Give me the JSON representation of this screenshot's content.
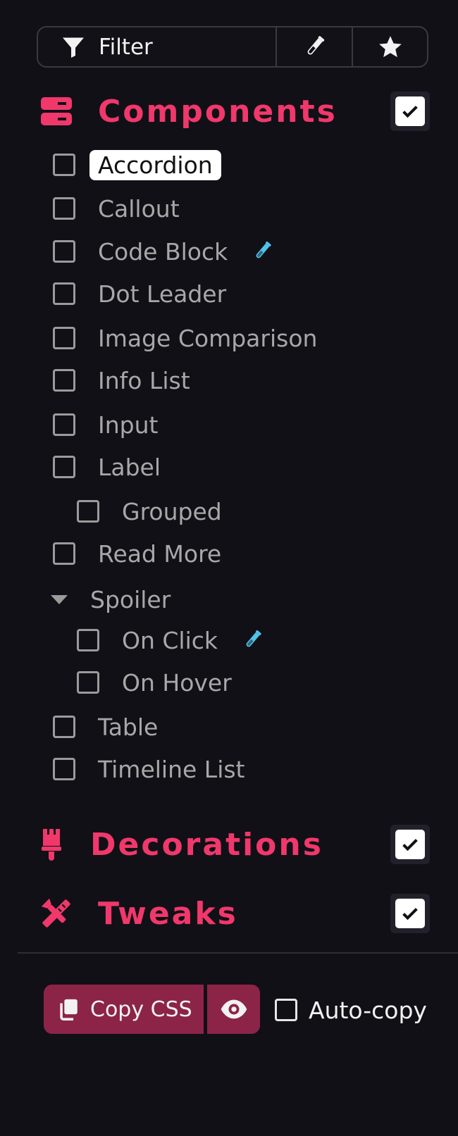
{
  "toolbar": {
    "filter_label": "Filter",
    "filter_icon": "funnel-icon",
    "beaker_icon": "beaker-icon",
    "star_icon": "star-icon"
  },
  "sections": {
    "components": {
      "title": "Components",
      "icon": "server-icon",
      "checked": true
    },
    "decorations": {
      "title": "Decorations",
      "icon": "paintbrush-icon",
      "checked": true
    },
    "tweaks": {
      "title": "Tweaks",
      "icon": "tools-icon",
      "checked": true
    }
  },
  "components": {
    "accordion": "Accordion",
    "callout": "Callout",
    "code_block": "Code Block",
    "dot_leader": "Dot Leader",
    "image_comparison": "Image Comparison",
    "info_list": "Info List",
    "input": "Input",
    "label": "Label",
    "grouped": "Grouped",
    "read_more": "Read More",
    "spoiler": "Spoiler",
    "on_click": "On Click",
    "on_hover": "On Hover",
    "table": "Table",
    "timeline_list": "Timeline List"
  },
  "footer": {
    "copy_label": "Copy CSS",
    "autocopy_label": "Auto-copy",
    "copy_icon": "copy-icon",
    "eye_icon": "eye-icon"
  },
  "colors": {
    "background": "#111017",
    "accent": "#f0386b",
    "button": "#8c2447",
    "beaker": "#4fc3e8"
  }
}
